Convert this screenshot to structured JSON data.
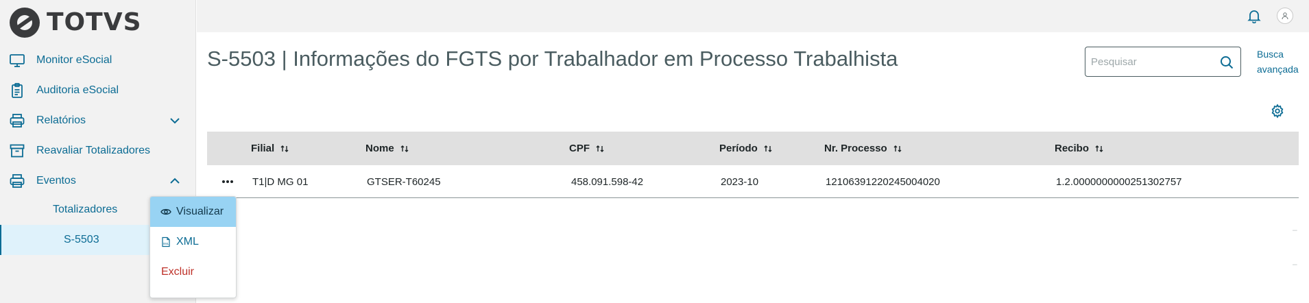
{
  "brand": {
    "name": "TOTVS"
  },
  "sidebar": {
    "items": [
      {
        "label": "Monitor eSocial",
        "icon": "monitor-icon"
      },
      {
        "label": "Auditoria eSocial",
        "icon": "clipboard-icon"
      },
      {
        "label": "Relatórios",
        "icon": "printer-icon",
        "expanded": false
      },
      {
        "label": "Reavaliar Totalizadores",
        "icon": "archive-icon"
      },
      {
        "label": "Eventos",
        "icon": "printer-icon",
        "expanded": true
      }
    ],
    "subitems": [
      {
        "label": "Totalizadores",
        "active": false
      },
      {
        "label": "S-5503",
        "active": true
      }
    ]
  },
  "topbar": {
    "icons": [
      "bell-icon",
      "user-icon"
    ]
  },
  "page": {
    "title": "S-5503 | Informações do FGTS por Trabalhador em Processo Trabalhista",
    "search_placeholder": "Pesquisar",
    "advanced_search_line1": "Busca",
    "advanced_search_line2": "avançada"
  },
  "table": {
    "columns": [
      "Filial",
      "Nome",
      "CPF",
      "Período",
      "Nr. Processo",
      "Recibo"
    ],
    "rows": [
      {
        "filial": "T1|D MG 01",
        "nome": "GTSER-T60245",
        "cpf": "458.091.598-42",
        "periodo": "2023-10",
        "processo": "12106391220245004020",
        "recibo": "1.2.0000000000251302757"
      }
    ]
  },
  "popup_menu": {
    "items": [
      {
        "label": "Visualizar",
        "icon": "eye-icon",
        "highlighted": true
      },
      {
        "label": "XML",
        "icon": "xml-file-icon"
      },
      {
        "label": "Excluir",
        "danger": true
      }
    ]
  },
  "colors": {
    "accent": "#0c6c94",
    "sidebar_bg": "#f2f2f2",
    "header_bg": "#e0e0e0",
    "highlight": "#98d3f3",
    "danger": "#be3028"
  }
}
